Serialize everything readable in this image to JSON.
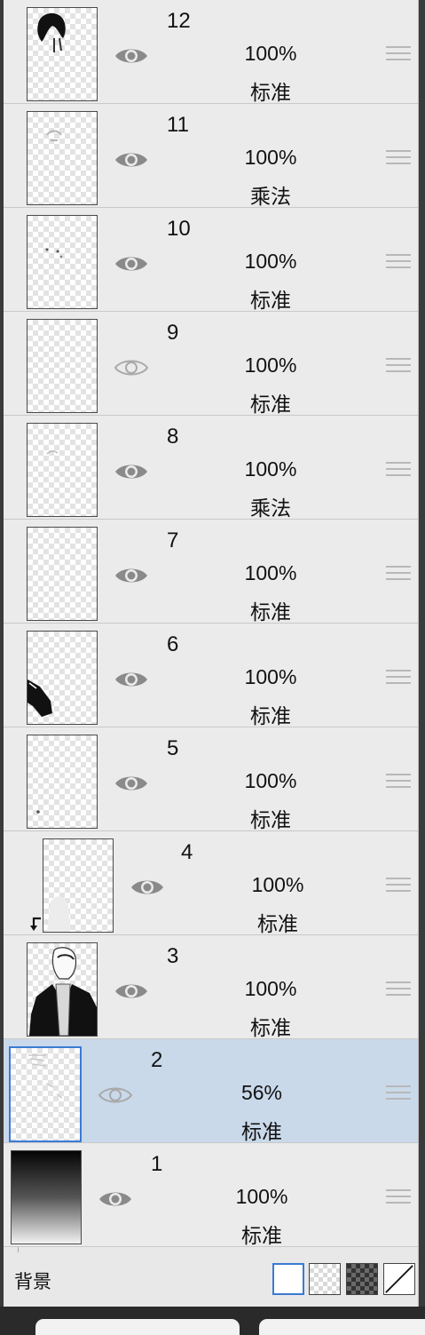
{
  "layers": [
    {
      "number": "12",
      "opacity": "100%",
      "blend": "标准",
      "visible": true,
      "thumb": "hair"
    },
    {
      "number": "11",
      "opacity": "100%",
      "blend": "乘法",
      "visible": true,
      "thumb": "faint"
    },
    {
      "number": "10",
      "opacity": "100%",
      "blend": "标准",
      "visible": true,
      "thumb": "dots"
    },
    {
      "number": "9",
      "opacity": "100%",
      "blend": "标准",
      "visible": false,
      "thumb": "empty"
    },
    {
      "number": "8",
      "opacity": "100%",
      "blend": "乘法",
      "visible": true,
      "thumb": "faint"
    },
    {
      "number": "7",
      "opacity": "100%",
      "blend": "标准",
      "visible": true,
      "thumb": "empty"
    },
    {
      "number": "6",
      "opacity": "100%",
      "blend": "标准",
      "visible": true,
      "thumb": "sleeve"
    },
    {
      "number": "5",
      "opacity": "100%",
      "blend": "标准",
      "visible": true,
      "thumb": "dot"
    },
    {
      "number": "4",
      "opacity": "100%",
      "blend": "标准",
      "visible": true,
      "thumb": "clip",
      "clipped": true
    },
    {
      "number": "3",
      "opacity": "100%",
      "blend": "标准",
      "visible": true,
      "thumb": "figure"
    },
    {
      "number": "2",
      "opacity": "56%",
      "blend": "标准",
      "visible": false,
      "thumb": "sketch",
      "selected": true
    },
    {
      "number": "1",
      "opacity": "100%",
      "blend": "标准",
      "visible": true,
      "thumb": "gradient"
    }
  ],
  "background": {
    "label": "背景",
    "swatches": [
      "white",
      "light-checker",
      "dark-checker",
      "transparent"
    ],
    "selected": "white"
  },
  "colors": {
    "selected_row": "#c9d9ea",
    "selected_border": "#3a7bd5",
    "eye_visible": "#8a8a8a",
    "eye_hidden": "#a9a9a9"
  }
}
